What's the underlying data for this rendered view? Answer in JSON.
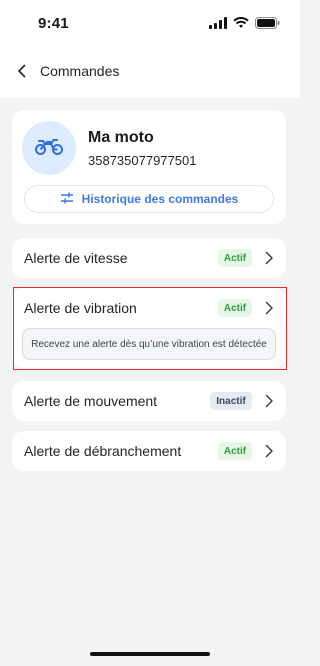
{
  "status_bar": {
    "time": "9:41",
    "icons": [
      "signal-icon",
      "wifi-icon",
      "battery-icon"
    ]
  },
  "nav": {
    "back_icon": "chevron-left-icon",
    "title": "Commandes"
  },
  "device": {
    "name": "Ma moto",
    "id": "358735077977501",
    "icon": "motorcycle-icon",
    "history_label": "Historique des commandes",
    "history_icon": "sliders-icon"
  },
  "alerts": [
    {
      "label": "Alerte de vitesse",
      "status": "Actif",
      "active": true
    },
    {
      "label": "Alerte de vibration",
      "status": "Actif",
      "active": true,
      "description": "Recevez une alerte dès qu’une vibration est détectée"
    },
    {
      "label": "Alerte de mouvement",
      "status": "Inactif",
      "active": false
    },
    {
      "label": "Alerte de débranchement",
      "status": "Actif",
      "active": true
    }
  ],
  "colors": {
    "accent": "#3E79E8",
    "active_bg": "#E7F7E7",
    "active_text": "#2E9F3A",
    "inactive_bg": "#E6EAF2",
    "highlight": "#E12C2C"
  }
}
